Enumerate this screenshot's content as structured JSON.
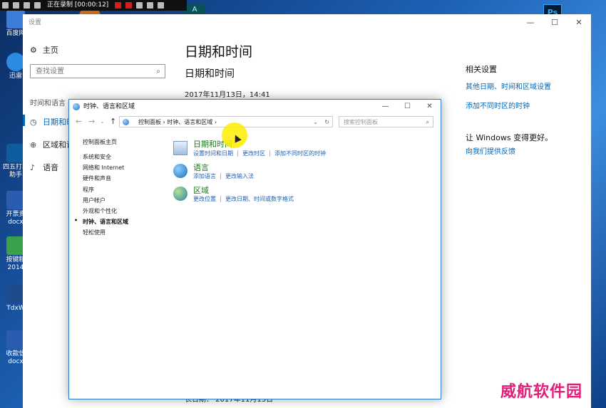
{
  "recording": {
    "label": "正在录制 [00:00:12]"
  },
  "desktop_icons": [
    {
      "label": "百度网"
    },
    {
      "label": "迅雷"
    },
    {
      "label": "四五打印助手"
    },
    {
      "label": "开票资docx"
    },
    {
      "label": "按键精2014"
    },
    {
      "label": "TdxW"
    },
    {
      "label": "收款信docx"
    }
  ],
  "desktop_right_icons": {
    "ps": "Ps",
    "app": "A"
  },
  "settings": {
    "title": "设置",
    "home": "主页",
    "search_placeholder": "查找设置",
    "category": "时间和语言",
    "nav": [
      {
        "label": "日期和时",
        "icon": "clock-icon"
      },
      {
        "label": "区域和语",
        "icon": "globe-icon"
      },
      {
        "label": "语音",
        "icon": "microphone-icon"
      }
    ],
    "page_title": "日期和时间",
    "section_title": "日期和时间",
    "current_datetime": "2017年11月13日，14:41",
    "bottom_text": "长日期：        2017年11月13日",
    "related_heading": "相关设置",
    "related_links": [
      "其他日期、时间和区域设置",
      "添加不同时区的时钟"
    ],
    "feedback_heading": "让 Windows 变得更好。",
    "feedback_link": "向我们提供反馈",
    "window_buttons": {
      "minimize": "—",
      "maximize": "☐",
      "close": "✕"
    }
  },
  "control_panel": {
    "title": "时钟、语言和区域",
    "address": "控制面板  ›  时钟、语言和区域  ›",
    "search_placeholder": "搜索控制面板",
    "left_nav": [
      "控制面板主页",
      "系统和安全",
      "网络和 Internet",
      "硬件和声音",
      "程序",
      "用户帐户",
      "外观和个性化",
      "时钟、语言和区域",
      "轻松使用"
    ],
    "categories": [
      {
        "title": "日期和时间",
        "links": [
          "设置时间和日期",
          "更改时区",
          "添加不同时区的时钟"
        ],
        "icon": "calendar-icon"
      },
      {
        "title": "语言",
        "links": [
          "添加语言",
          "更改输入法"
        ],
        "icon": "language-icon"
      },
      {
        "title": "区域",
        "links": [
          "更改位置",
          "更改日期、时间或数字格式"
        ],
        "icon": "region-globe-icon"
      }
    ],
    "window_buttons": {
      "minimize": "—",
      "maximize": "☐",
      "close": "✕"
    }
  },
  "watermark": "威航软件园"
}
